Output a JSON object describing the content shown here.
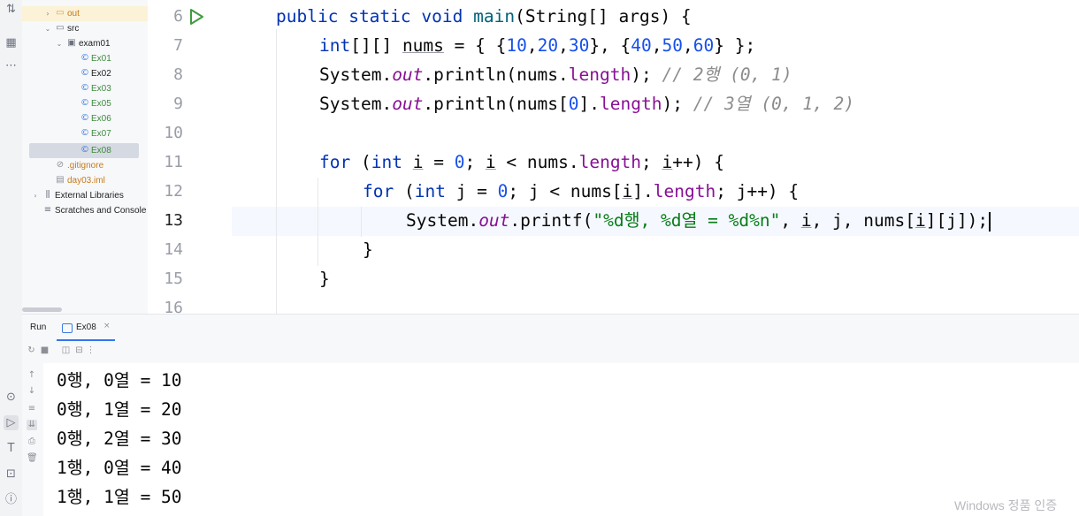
{
  "project_tree": {
    "out_label": "out",
    "src_label": "src",
    "package_label": "exam01",
    "classes": [
      "Ex01",
      "Ex02",
      "Ex03",
      "Ex05",
      "Ex06",
      "Ex07",
      "Ex08"
    ],
    "gitignore_label": ".gitignore",
    "iml_label": "day03.iml",
    "external_libraries_label": "External Libraries",
    "scratches_label": "Scratches and Console"
  },
  "editor": {
    "line_numbers": [
      "6",
      "7",
      "8",
      "9",
      "10",
      "11",
      "12",
      "13",
      "14",
      "15",
      "16"
    ],
    "current_line": "13",
    "code": {
      "l6": [
        "public",
        "static",
        "void",
        "main",
        "(String[] args) {"
      ],
      "l7": [
        "int",
        "[][] ",
        "nums",
        " = { {",
        "10",
        ",",
        "20",
        ",",
        "30",
        "}, {",
        "40",
        ",",
        "50",
        ",",
        "60",
        "} };"
      ],
      "l8": [
        "System.",
        "out",
        ".println(nums.",
        "length",
        "); ",
        "// 2행 (0, 1)"
      ],
      "l9": [
        "System.",
        "out",
        ".println(nums[",
        "0",
        "].",
        "length",
        "); ",
        "// 3열 (0, 1, 2)"
      ],
      "l11": [
        "for",
        " (",
        "int",
        " ",
        "i",
        " = ",
        "0",
        "; ",
        "i",
        " < nums.",
        "length",
        "; ",
        "i",
        "++) {"
      ],
      "l12": [
        "for",
        " (",
        "int",
        " j = ",
        "0",
        "; j < nums[",
        "i",
        "].",
        "length",
        "; j++) {"
      ],
      "l13": [
        "System.",
        "out",
        ".printf(",
        "\"%d행, %d열 = %d%n\"",
        ", ",
        "i",
        ", j, nums[",
        "i",
        "][j]);"
      ],
      "l14": "}",
      "l15": "}"
    }
  },
  "run_panel": {
    "title": "Run",
    "tab_label": "Ex08",
    "tab_close": "×",
    "output_lines": [
      "0행, 0열 = 10",
      "0행, 1열 = 20",
      "0행, 2열 = 30",
      "1행, 0열 = 40",
      "1행, 1열 = 50"
    ]
  },
  "watermark": "Windows 정품 인증",
  "colors": {
    "keyword": "#0033b3",
    "number": "#1750eb",
    "field": "#871094",
    "method": "#00627a",
    "comment": "#8c8c8c",
    "string": "#067d17",
    "accent": "#3574f0"
  }
}
